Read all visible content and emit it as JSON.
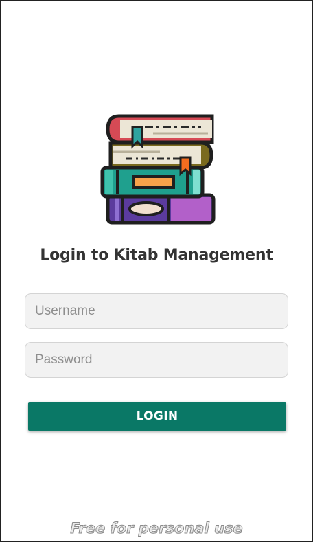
{
  "login": {
    "logo_icon": "stack-of-books-icon",
    "title": "Login to Kitab Management",
    "username_placeholder": "Username",
    "password_placeholder": "Password",
    "login_button_label": "LOGIN",
    "accent_color": "#0a7866"
  },
  "watermark": {
    "text": "Free for personal use"
  }
}
